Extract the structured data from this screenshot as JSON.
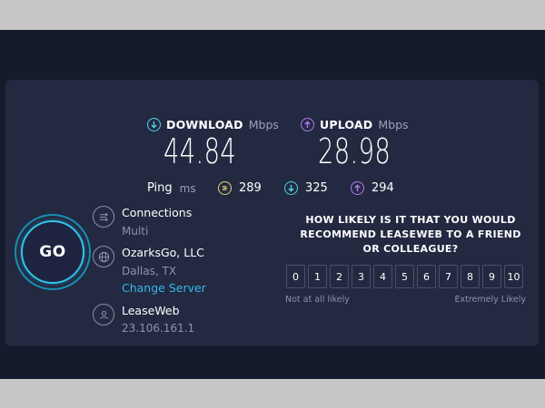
{
  "colors": {
    "accent_download": "#4dd6e6",
    "accent_upload": "#b27cf2",
    "accent_ping": "#e8d36a",
    "link": "#38b7e8"
  },
  "download": {
    "label": "DOWNLOAD",
    "unit": "Mbps",
    "value": "44.84",
    "icon": "arrow-down-circle-icon"
  },
  "upload": {
    "label": "UPLOAD",
    "unit": "Mbps",
    "value": "28.98",
    "icon": "arrow-up-circle-icon"
  },
  "ping": {
    "label": "Ping",
    "unit": "ms",
    "idle": "289",
    "download": "325",
    "upload": "294"
  },
  "go_button": {
    "label": "GO"
  },
  "connections": {
    "title": "Connections",
    "value": "Multi",
    "icon": "connections-icon"
  },
  "isp": {
    "name": "OzarksGo, LLC",
    "location": "Dallas, TX",
    "change_link": "Change Server",
    "icon": "globe-icon"
  },
  "host": {
    "name": "LeaseWeb",
    "ip": "23.106.161.1",
    "icon": "user-icon"
  },
  "survey": {
    "question": "HOW LIKELY IS IT THAT YOU WOULD RECOMMEND LEASEWEB TO A FRIEND OR COLLEAGUE?",
    "options": [
      "0",
      "1",
      "2",
      "3",
      "4",
      "5",
      "6",
      "7",
      "8",
      "9",
      "10"
    ],
    "low_label": "Not at all likely",
    "high_label": "Extremely Likely"
  }
}
